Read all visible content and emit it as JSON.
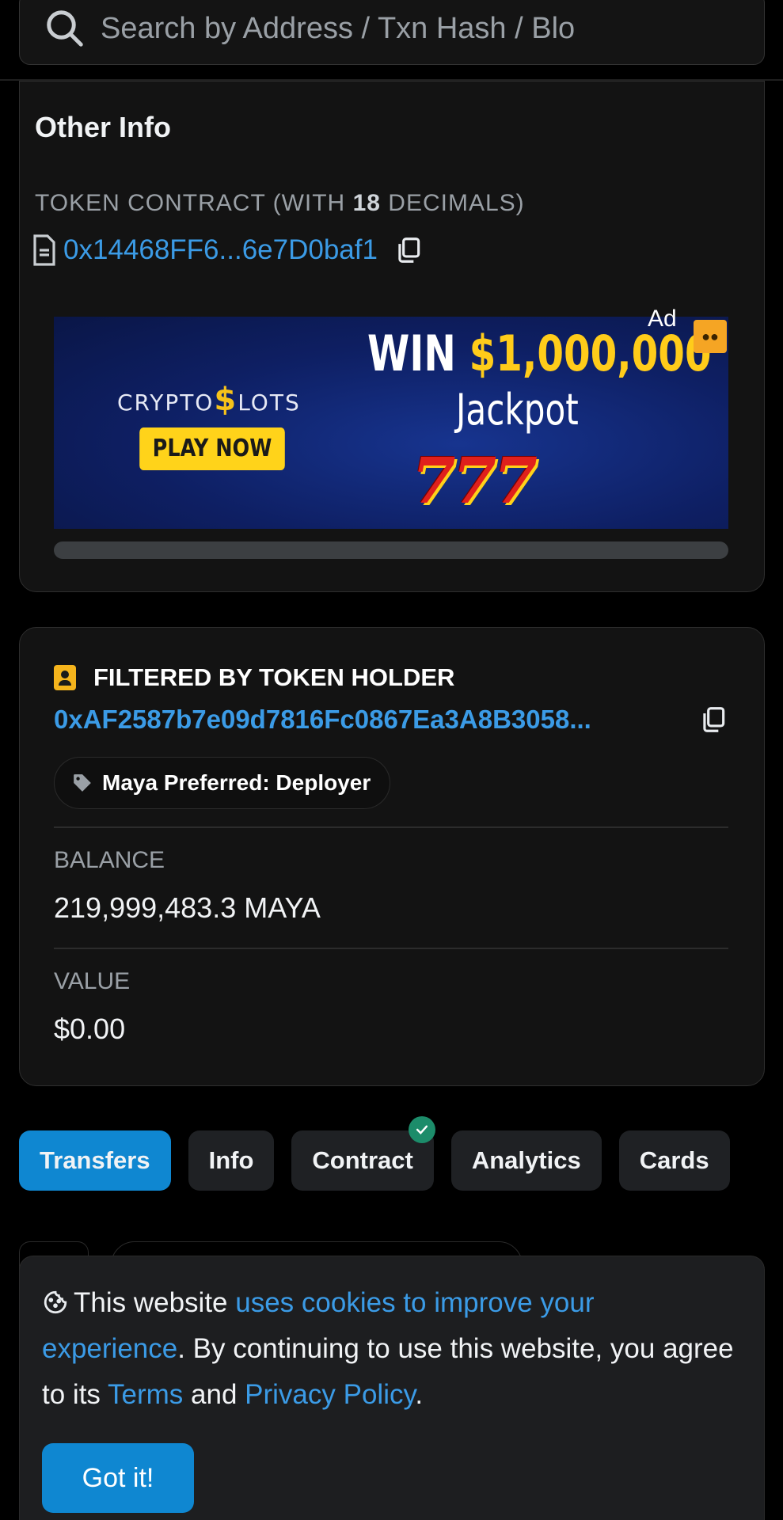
{
  "search": {
    "placeholder": "Search by Address / Txn Hash / Blo"
  },
  "other_info": {
    "title": "Other Info",
    "token_contract_prefix": "TOKEN CONTRACT (WITH ",
    "decimals": "18",
    "token_contract_suffix": " DECIMALS)",
    "contract_address": "0x14468FF6...6e7D0baf1"
  },
  "ad": {
    "label": "Ad",
    "brand_prefix": "CRYPTO",
    "brand_dollar": "$",
    "brand_suffix": "LOTS",
    "cta": "PLAY NOW",
    "win": "WIN",
    "amount": "$1,000,000",
    "jackpot": "Jackpot",
    "sevens": "777"
  },
  "holder": {
    "heading": "FILTERED BY TOKEN HOLDER",
    "address": "0xAF2587b7e09d7816Fc0867Ea3A8B3058...",
    "tag": "Maya Preferred: Deployer",
    "balance_label": "BALANCE",
    "balance_value": "219,999,483.3 MAYA",
    "value_label": "VALUE",
    "value_value": "$0.00"
  },
  "tabs": [
    {
      "label": "Transfers",
      "active": true
    },
    {
      "label": "Info",
      "active": false
    },
    {
      "label": "Contract",
      "active": false,
      "verified": true
    },
    {
      "label": "Analytics",
      "active": false
    },
    {
      "label": "Cards",
      "active": false
    }
  ],
  "cookie": {
    "t1": "This website ",
    "link1": "uses cookies to improve your experience",
    "t2": ". By continuing to use this website, you agree to its ",
    "link2": "Terms",
    "t3": " and ",
    "link3": "Privacy Policy",
    "t4": ".",
    "button": "Got it!"
  },
  "colors": {
    "accent": "#0f87d1",
    "link": "#3b9be6",
    "badge": "#f5b41c",
    "verified": "#1c8c6a"
  }
}
